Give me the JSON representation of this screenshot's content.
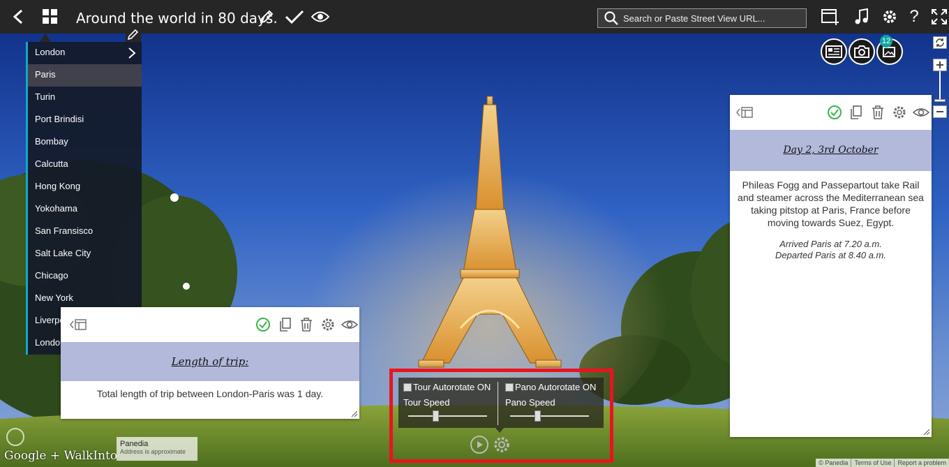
{
  "topbar": {
    "title": "Around the world in 80 days.",
    "search_placeholder": "Search or Paste Street View URL..."
  },
  "destinations": [
    {
      "label": "London",
      "active": false,
      "has_arrow": true
    },
    {
      "label": "Paris",
      "active": true
    },
    {
      "label": "Turin"
    },
    {
      "label": "Port Brindisi"
    },
    {
      "label": "Bombay"
    },
    {
      "label": "Calcutta"
    },
    {
      "label": "Hong Kong"
    },
    {
      "label": "Yokohama"
    },
    {
      "label": "San Fransisco"
    },
    {
      "label": "Salt Lake City"
    },
    {
      "label": "Chicago"
    },
    {
      "label": "New York"
    },
    {
      "label": "Liverpool"
    },
    {
      "label": "London"
    }
  ],
  "left_panel": {
    "heading": "Length of trip:",
    "body": "Total length of trip between London-Paris was 1 day."
  },
  "right_panel": {
    "heading": "Day 2, 3rd October",
    "body": "Phileas Fogg and Passepartout take Rail and steamer across the Mediterranean sea taking pitstop at Paris, France before moving towards Suez, Egypt.",
    "arrived": "Arrived Paris at 7.20 a.m.",
    "departed": "Departed Paris at 8.40 a.m."
  },
  "media": {
    "photo_count": "12"
  },
  "autorotate": {
    "tour_label": "Tour Autorotate ON",
    "tour_speed_label": "Tour Speed",
    "tour_speed_level": 0.35,
    "pano_label": "Pano Autorotate ON",
    "pano_speed_label": "Pano Speed",
    "pano_speed_level": 0.35
  },
  "footer": {
    "logo_text": "Google + WalkInto",
    "address_name": "Panedia",
    "address_note": "Address is approximate",
    "copyright": "© Panedia",
    "terms": "Terms of Use",
    "report": "Report a problem"
  },
  "colors": {
    "topbar": "#262626",
    "accent": "#14a8c8",
    "check_green": "#3ab54a",
    "panel_head": "#b3b9db",
    "highlight": "#e8141f",
    "badge": "#0fa3a3"
  }
}
